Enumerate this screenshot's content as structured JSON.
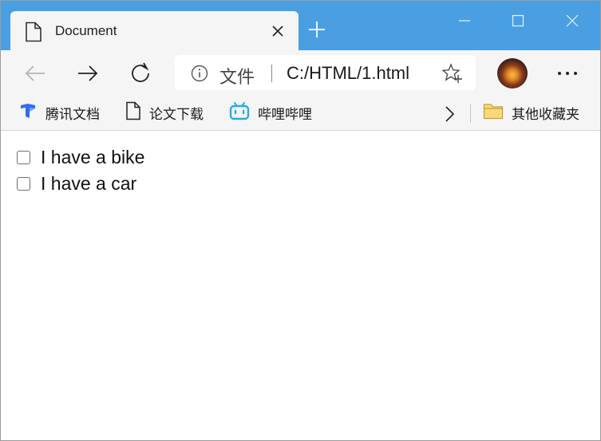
{
  "tab": {
    "title": "Document"
  },
  "toolbar": {
    "address": {
      "scheme_label": "文件",
      "url": "C:/HTML/1.html"
    }
  },
  "favorites": [
    {
      "label": "腾讯文档",
      "icon": "tencent-docs-icon",
      "color": "#2f6df0"
    },
    {
      "label": "论文下载",
      "icon": "page-icon"
    },
    {
      "label": "哔哩哔哩",
      "icon": "bilibili-icon",
      "color": "#23ade5"
    }
  ],
  "other_favorites": {
    "label": "其他收藏夹",
    "icon": "folder-icon",
    "color": "#f2c14e"
  },
  "page": {
    "checkboxes": [
      {
        "label": "I have a bike",
        "checked": false
      },
      {
        "label": "I have a car",
        "checked": false
      }
    ]
  },
  "colors": {
    "titlebar": "#4a9fe3",
    "toolbar": "#f5f5f5"
  }
}
